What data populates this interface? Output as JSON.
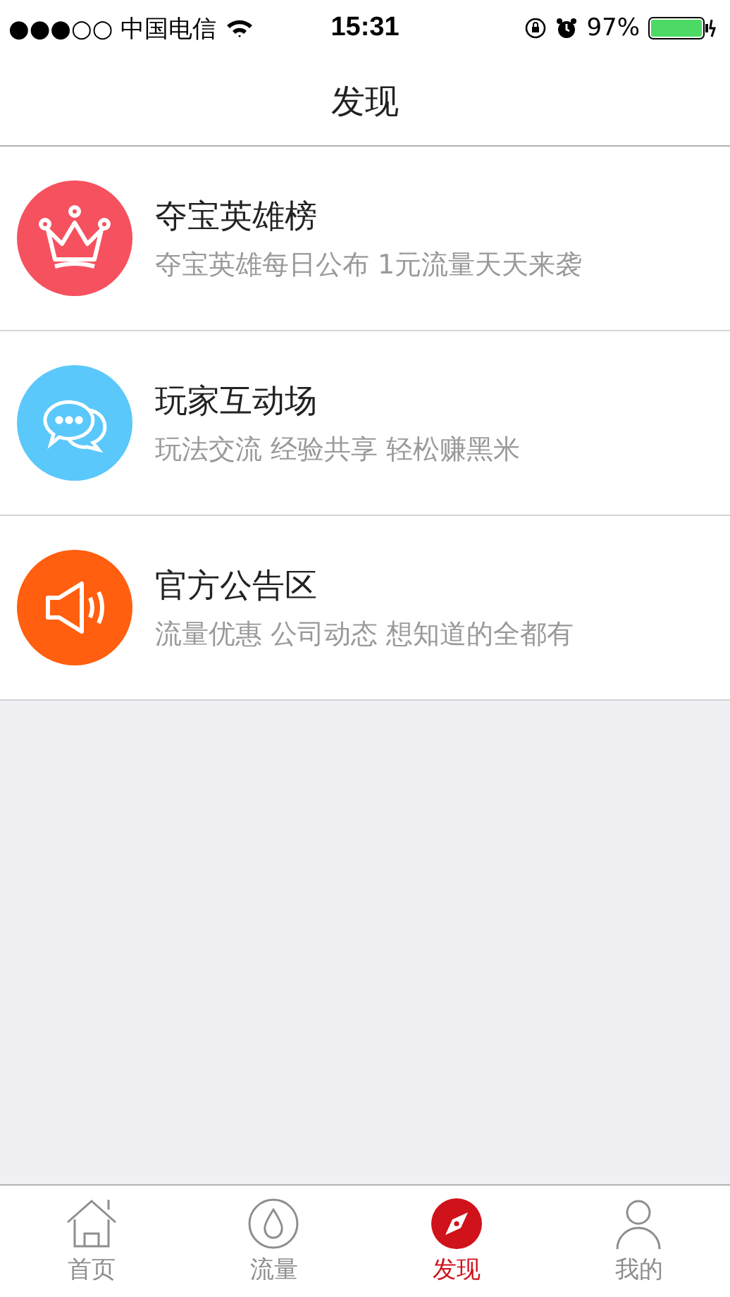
{
  "status_bar": {
    "carrier": "●●●○○ 中国电信",
    "time": "15:31",
    "battery": "97%"
  },
  "nav": {
    "title": "发现"
  },
  "items": [
    {
      "kind": "crown",
      "color": "#f6515f",
      "title": "夺宝英雄榜",
      "subtitle": "夺宝英雄每日公布 1元流量天天来袭"
    },
    {
      "kind": "chat",
      "color": "#5ac8fa",
      "title": "玩家互动场",
      "subtitle": "玩法交流 经验共享 轻松赚黑米"
    },
    {
      "kind": "speaker",
      "color": "#ff5f0f",
      "title": "官方公告区",
      "subtitle": "流量优惠 公司动态 想知道的全都有"
    }
  ],
  "tabs": [
    {
      "kind": "home",
      "label": "首页",
      "selected": false
    },
    {
      "kind": "drop",
      "label": "流量",
      "selected": false
    },
    {
      "kind": "compass",
      "label": "发现",
      "selected": true
    },
    {
      "kind": "person",
      "label": "我的",
      "selected": false
    }
  ]
}
